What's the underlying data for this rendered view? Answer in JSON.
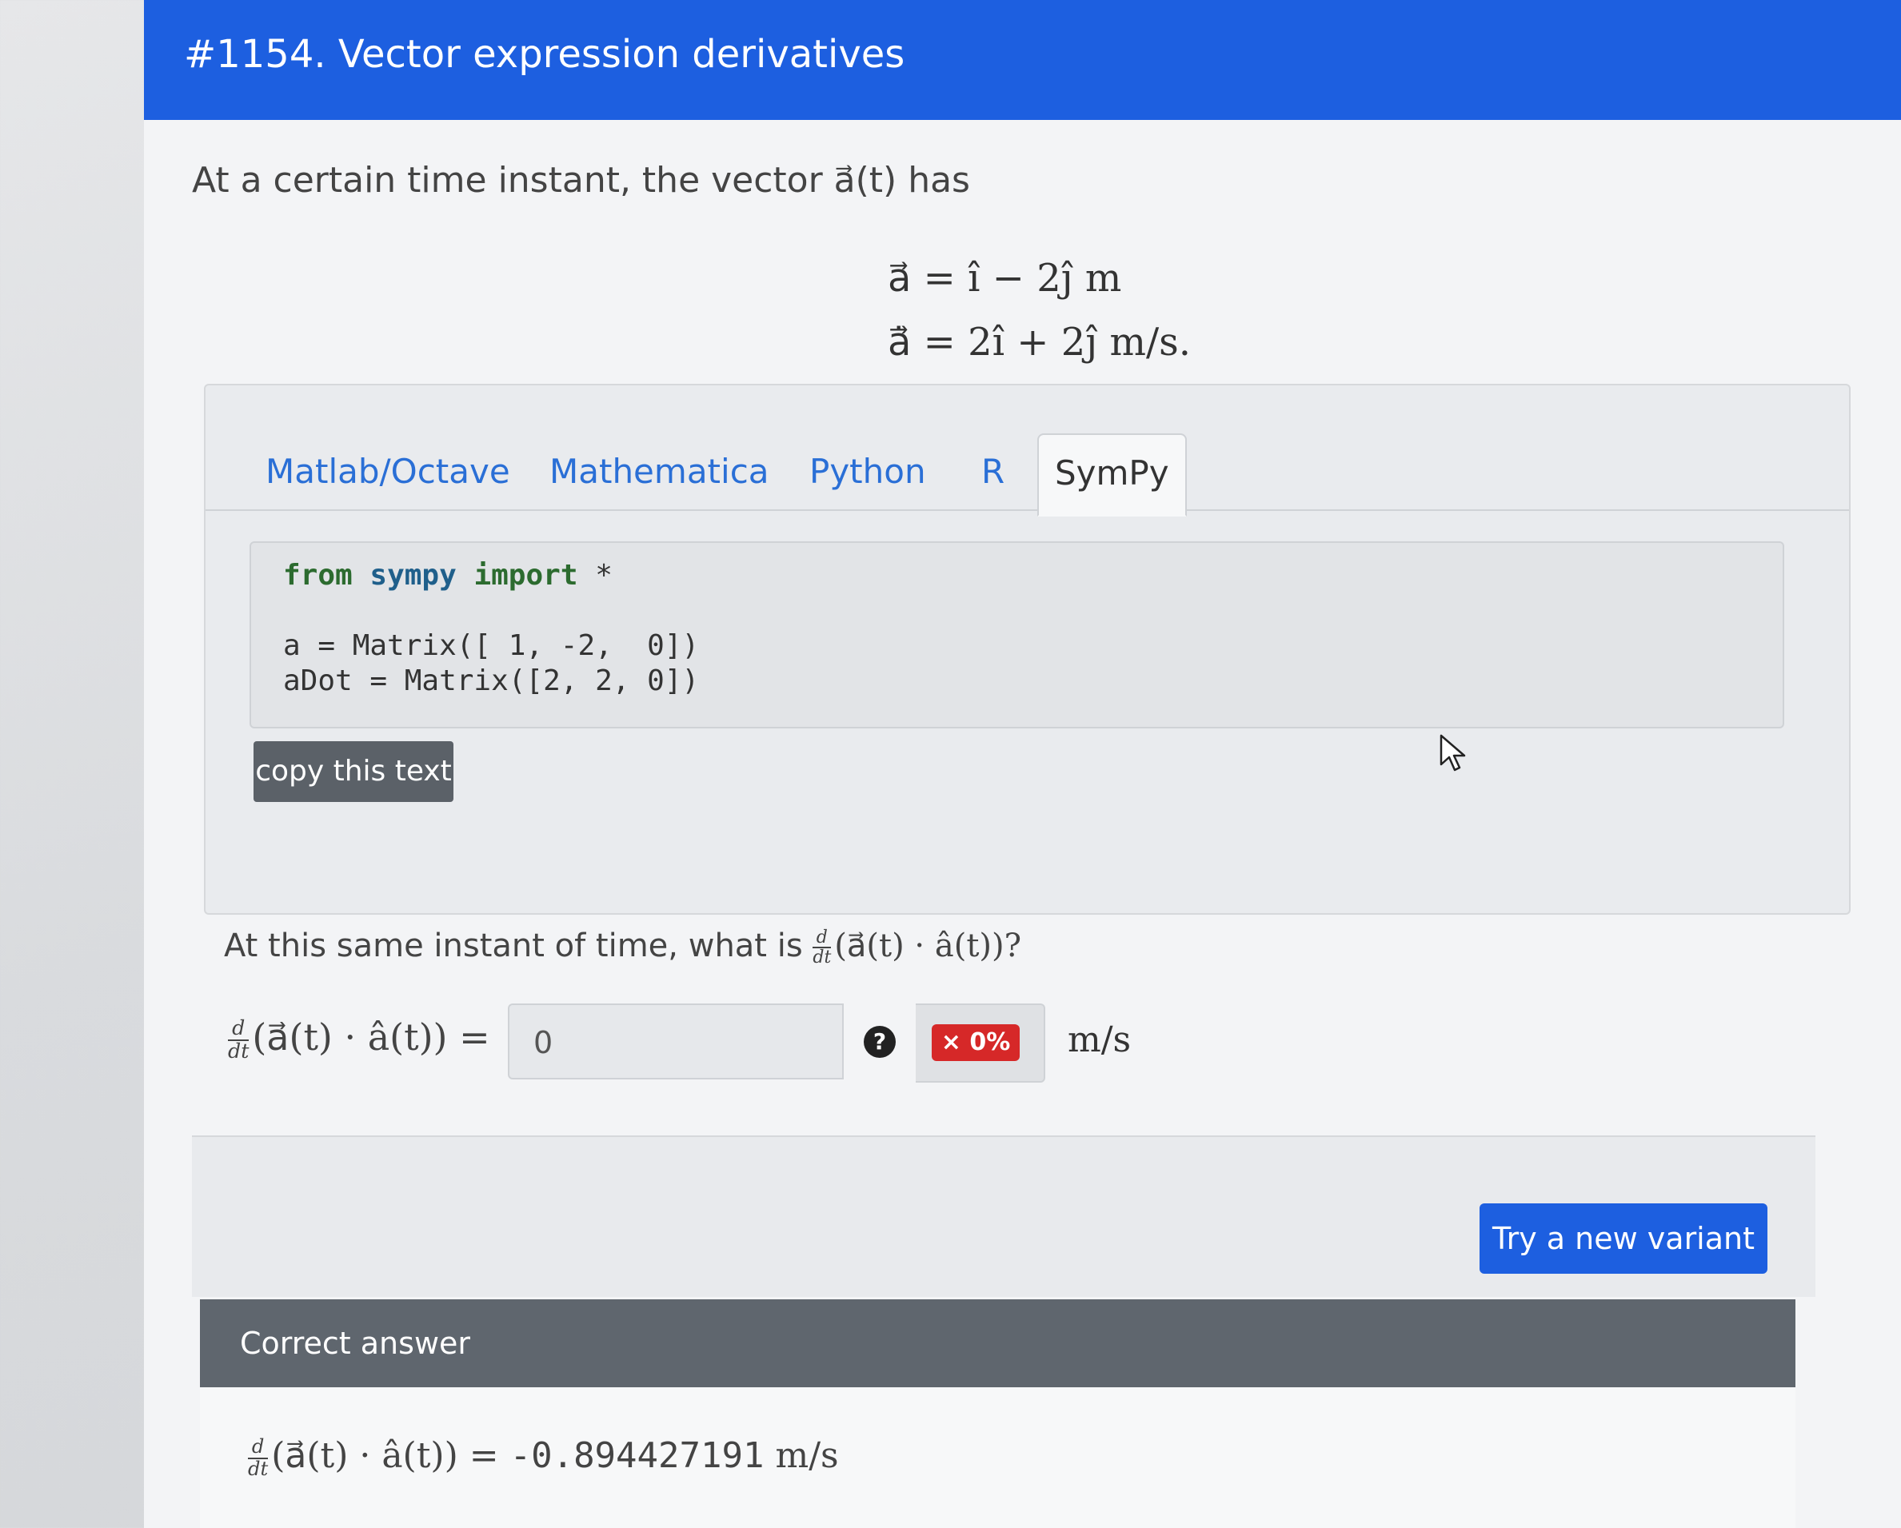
{
  "header": {
    "title": "#1154. Vector expression derivatives"
  },
  "intro": {
    "text": "At a certain time instant, the vector a⃗(t) has"
  },
  "equations": {
    "eq1": "a⃗ = ı̂ − 2ȷ̂ m",
    "eq2": "a⃗̇ = 2ı̂ + 2ȷ̂ m/s."
  },
  "tabs": [
    {
      "label": "Matlab/Octave",
      "active": false
    },
    {
      "label": "Mathematica",
      "active": false
    },
    {
      "label": "Python",
      "active": false
    },
    {
      "label": "R",
      "active": false
    },
    {
      "label": "SymPy",
      "active": true
    }
  ],
  "code": {
    "line1_kw1": "from",
    "line1_mod": "sympy",
    "line1_kw2": "import",
    "line1_star": "*",
    "line2": "a = Matrix([ 1, -2,  0])",
    "line3": "aDot = Matrix([2, 2, 0])",
    "copy_label": "copy this text"
  },
  "question": {
    "prefix": "At this same instant of time, what is",
    "expr": "(a⃗(t) · â(t))?"
  },
  "answer": {
    "lhs_expr": "(a⃗(t) · â(t)) =",
    "input_value": "0",
    "help_symbol": "?",
    "grade": "× 0%",
    "units": "m/s"
  },
  "frac": {
    "top": "d",
    "bottom": "dt"
  },
  "actions": {
    "try_new_variant": "Try a new variant"
  },
  "correct": {
    "header": "Correct answer",
    "expr": "(a⃗(t) · â(t)) =",
    "value": "-0.894427191",
    "units": "m/s"
  },
  "colors": {
    "header_bg": "#1d5fe0",
    "tab_link": "#2a6fd6",
    "grade_red": "#d62828",
    "correct_header_bg": "#5f666e"
  }
}
